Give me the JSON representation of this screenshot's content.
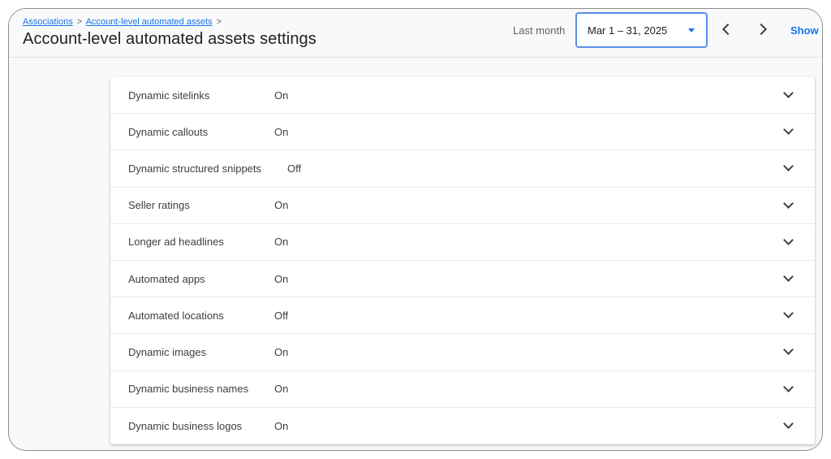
{
  "breadcrumb": {
    "items": [
      "Associations",
      "Account-level automated assets"
    ],
    "separator": ">"
  },
  "page": {
    "title": "Account-level automated assets settings"
  },
  "date_range": {
    "label": "Last month",
    "value": "Mar 1 – 31, 2025"
  },
  "header_actions": {
    "show_label": "Show l"
  },
  "settings": [
    {
      "label": "Dynamic sitelinks",
      "status": "On"
    },
    {
      "label": "Dynamic callouts",
      "status": "On"
    },
    {
      "label": "Dynamic structured snippets",
      "status": "Off"
    },
    {
      "label": "Seller ratings",
      "status": "On"
    },
    {
      "label": "Longer ad headlines",
      "status": "On"
    },
    {
      "label": "Automated apps",
      "status": "On"
    },
    {
      "label": "Automated locations",
      "status": "Off"
    },
    {
      "label": "Dynamic images",
      "status": "On"
    },
    {
      "label": "Dynamic business names",
      "status": "On"
    },
    {
      "label": "Dynamic business logos",
      "status": "On"
    }
  ],
  "colors": {
    "accent": "#1a73e8",
    "picker_border": "#5b8ee6"
  }
}
